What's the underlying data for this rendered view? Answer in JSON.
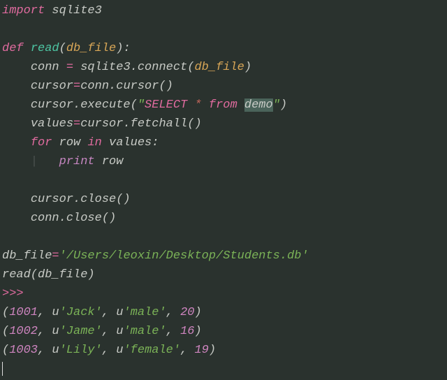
{
  "code": {
    "l0_import": "import",
    "l0_mod": " sqlite3",
    "l2_def": "def",
    "l2_sp": " ",
    "l2_fn": "read",
    "l2_op": "(",
    "l2_par": "db_file",
    "l2_cp": ")",
    "l2_colon": ":",
    "l3_ind": "    ",
    "l3_t1": "conn ",
    "l3_eq": "=",
    "l3_t2": " sqlite3.connect(",
    "l3_par": "db_file",
    "l3_t3": ")",
    "l4_ind": "    ",
    "l4_t1": "cursor",
    "l4_eq": "=",
    "l4_t2": "conn.cursor()",
    "l5_ind": "    ",
    "l5_t1": "cursor.execute(",
    "l5_q1": "\"",
    "l5_s1": "SELECT",
    "l5_sp1": " ",
    "l5_s2": "*",
    "l5_sp2": " ",
    "l5_s3": "from",
    "l5_sp3": " ",
    "l5_s4": "demo",
    "l5_q2": "\"",
    "l5_t2": ")",
    "l6_ind": "    ",
    "l6_t1": "values",
    "l6_eq": "=",
    "l6_t2": "cursor.fetchall()",
    "l7_ind": "    ",
    "l7_for": "for",
    "l7_t1": " row ",
    "l7_in": "in",
    "l7_t2": " values:",
    "l8_ind": "    ",
    "l8_guide": "|   ",
    "l8_pr": "print",
    "l8_t1": " row",
    "l10_ind": "    ",
    "l10_t1": "cursor.close()",
    "l11_ind": "    ",
    "l11_t1": "conn.close()",
    "l13_t1": "db_file",
    "l13_eq": "=",
    "l13_str": "'/Users/leoxin/Desktop/Students.db'",
    "l14_t1": "read(db_file)"
  },
  "output": {
    "prompt": ">>>",
    "r1a": "(",
    "r1n": "1001",
    "r1b": ", u",
    "r1s1": "'Jack'",
    "r1c": ", u",
    "r1s2": "'male'",
    "r1d": ", ",
    "r1n2": "20",
    "r1e": ")",
    "r2a": "(",
    "r2n": "1002",
    "r2b": ", u",
    "r2s1": "'Jame'",
    "r2c": ", u",
    "r2s2": "'male'",
    "r2d": ", ",
    "r2n2": "16",
    "r2e": ")",
    "r3a": "(",
    "r3n": "1003",
    "r3b": ", u",
    "r3s1": "'Lily'",
    "r3c": ", u",
    "r3s2": "'female'",
    "r3d": ", ",
    "r3n2": "19",
    "r3e": ")"
  }
}
